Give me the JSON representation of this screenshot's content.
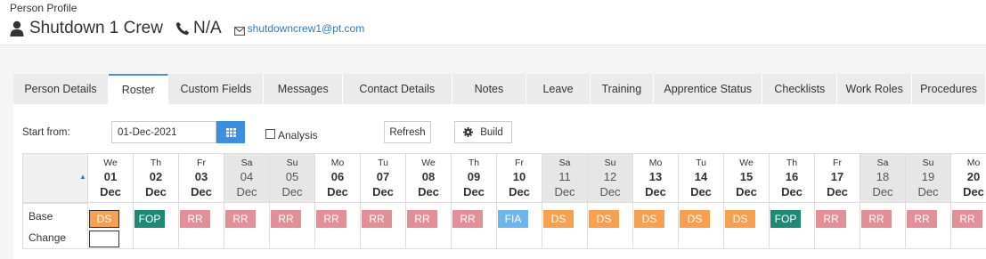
{
  "header": {
    "profile_label": "Person Profile",
    "name": "Shutdown 1 Crew",
    "phone": "N/A",
    "email": "shutdowncrew1@pt.com"
  },
  "tabs": [
    {
      "label": "Person Details"
    },
    {
      "label": "Roster",
      "active": true
    },
    {
      "label": "Custom Fields"
    },
    {
      "label": "Messages"
    },
    {
      "label": "Contact Details"
    },
    {
      "label": "Notes"
    },
    {
      "label": "Leave"
    },
    {
      "label": "Training"
    },
    {
      "label": "Apprentice Status"
    },
    {
      "label": "Checklists"
    },
    {
      "label": "Work Roles"
    },
    {
      "label": "Procedures"
    }
  ],
  "toolbar": {
    "start_label": "Start from:",
    "start_date": "01-Dec-2021",
    "analysis_label": "Analysis",
    "analysis_checked": false,
    "refresh_label": "Refresh",
    "build_label": "Build"
  },
  "roster": {
    "row_labels": {
      "base": "Base",
      "change": "Change"
    },
    "shift_colors": {
      "DS": "#f9a04e",
      "FOP": "#1e8a76",
      "RR": "#e28f98",
      "FIA": "#6bb6ec"
    },
    "days": [
      {
        "dow": "We",
        "num": "01",
        "mon": "Dec",
        "shift": "DS",
        "weekend": false,
        "selected": true
      },
      {
        "dow": "Th",
        "num": "02",
        "mon": "Dec",
        "shift": "FOP",
        "weekend": false
      },
      {
        "dow": "Fr",
        "num": "03",
        "mon": "Dec",
        "shift": "RR",
        "weekend": false
      },
      {
        "dow": "Sa",
        "num": "04",
        "mon": "Dec",
        "shift": "RR",
        "weekend": true
      },
      {
        "dow": "Su",
        "num": "05",
        "mon": "Dec",
        "shift": "RR",
        "weekend": true
      },
      {
        "dow": "Mo",
        "num": "06",
        "mon": "Dec",
        "shift": "RR",
        "weekend": false
      },
      {
        "dow": "Tu",
        "num": "07",
        "mon": "Dec",
        "shift": "RR",
        "weekend": false
      },
      {
        "dow": "We",
        "num": "08",
        "mon": "Dec",
        "shift": "RR",
        "weekend": false
      },
      {
        "dow": "Th",
        "num": "09",
        "mon": "Dec",
        "shift": "RR",
        "weekend": false
      },
      {
        "dow": "Fr",
        "num": "10",
        "mon": "Dec",
        "shift": "FIA",
        "weekend": false
      },
      {
        "dow": "Sa",
        "num": "11",
        "mon": "Dec",
        "shift": "DS",
        "weekend": true
      },
      {
        "dow": "Su",
        "num": "12",
        "mon": "Dec",
        "shift": "DS",
        "weekend": true
      },
      {
        "dow": "Mo",
        "num": "13",
        "mon": "Dec",
        "shift": "DS",
        "weekend": false
      },
      {
        "dow": "Tu",
        "num": "14",
        "mon": "Dec",
        "shift": "DS",
        "weekend": false
      },
      {
        "dow": "We",
        "num": "15",
        "mon": "Dec",
        "shift": "DS",
        "weekend": false
      },
      {
        "dow": "Th",
        "num": "16",
        "mon": "Dec",
        "shift": "FOP",
        "weekend": false
      },
      {
        "dow": "Fr",
        "num": "17",
        "mon": "Dec",
        "shift": "RR",
        "weekend": false
      },
      {
        "dow": "Sa",
        "num": "18",
        "mon": "Dec",
        "shift": "RR",
        "weekend": true
      },
      {
        "dow": "Su",
        "num": "19",
        "mon": "Dec",
        "shift": "RR",
        "weekend": true
      },
      {
        "dow": "Mo",
        "num": "20",
        "mon": "Dec",
        "shift": "RR",
        "weekend": false
      }
    ]
  }
}
